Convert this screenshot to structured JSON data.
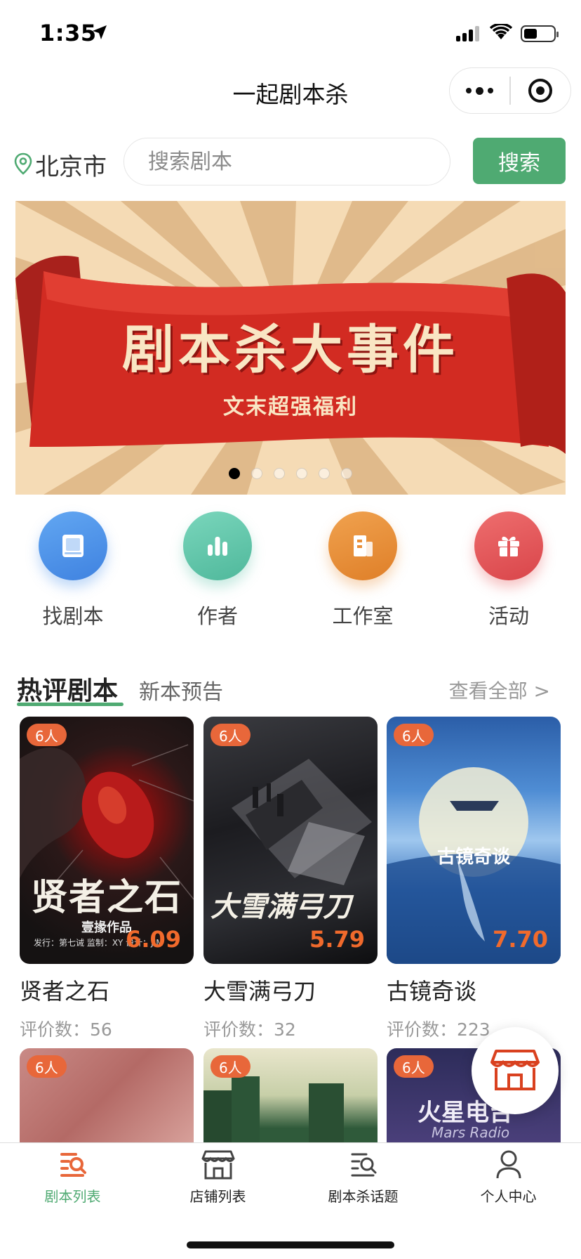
{
  "status_bar": {
    "time": "1:35"
  },
  "nav": {
    "title": "一起剧本杀"
  },
  "search": {
    "city": "北京市",
    "placeholder": "搜索剧本",
    "button_label": "搜索"
  },
  "banner": {
    "title": "剧本杀大事件",
    "subtitle": "文末超强福利",
    "page_count": 6,
    "active_index": 0
  },
  "categories": [
    {
      "label": "找剧本",
      "icon": "book-icon",
      "color": "#4b93ea"
    },
    {
      "label": "作者",
      "icon": "bar-chart-icon",
      "color": "#5fc4a8"
    },
    {
      "label": "工作室",
      "icon": "building-icon",
      "color": "#e98f38"
    },
    {
      "label": "活动",
      "icon": "gift-icon",
      "color": "#e4555a"
    }
  ],
  "section": {
    "tab_hot": "热评剧本",
    "tab_new": "新本预告",
    "view_all": "查看全部 >"
  },
  "scripts": [
    {
      "badge": "6人",
      "name": "贤者之石",
      "score": "6.09",
      "reviews": "评价数：56",
      "poster_title": "贤者之石",
      "poster_sub": "壹掾作品",
      "poster_credit": "发行：第七诫   监制：XY   设计：JIM"
    },
    {
      "badge": "6人",
      "name": "大雪满弓刀",
      "score": "5.79",
      "reviews": "评价数：32",
      "poster_title": "大雪满弓刀"
    },
    {
      "badge": "6人",
      "name": "古镜奇谈",
      "score": "7.70",
      "reviews": "评价数：223",
      "poster_title": "古镜奇谈"
    },
    {
      "badge": "6人"
    },
    {
      "badge": "6人"
    },
    {
      "badge": "6人",
      "poster_title": "火星电台",
      "poster_sub": "Mars Radio"
    }
  ],
  "tab_bar": [
    {
      "label": "剧本列表",
      "icon": "list-search-icon",
      "active": true
    },
    {
      "label": "店铺列表",
      "icon": "shop-icon",
      "active": false
    },
    {
      "label": "剧本杀话题",
      "icon": "topic-icon",
      "active": false
    },
    {
      "label": "个人中心",
      "icon": "user-icon",
      "active": false
    }
  ],
  "colors": {
    "accent": "#4faa72",
    "score": "#f16a2c",
    "badge": "#e8673a"
  }
}
